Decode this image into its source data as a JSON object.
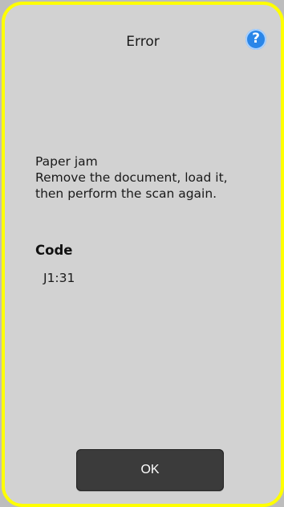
{
  "dialog": {
    "title": "Error",
    "help_icon": "question-mark-circle-icon",
    "message": {
      "line1": "Paper jam",
      "line2": "Remove the document, load it,",
      "line3": "then perform the scan again."
    },
    "code_label": "Code",
    "code_value": "J1:31",
    "ok_label": "OK"
  },
  "colors": {
    "border": "#ffff00",
    "background": "#d2d2d2",
    "button": "#3b3b3b",
    "help": "#2a86e8"
  }
}
